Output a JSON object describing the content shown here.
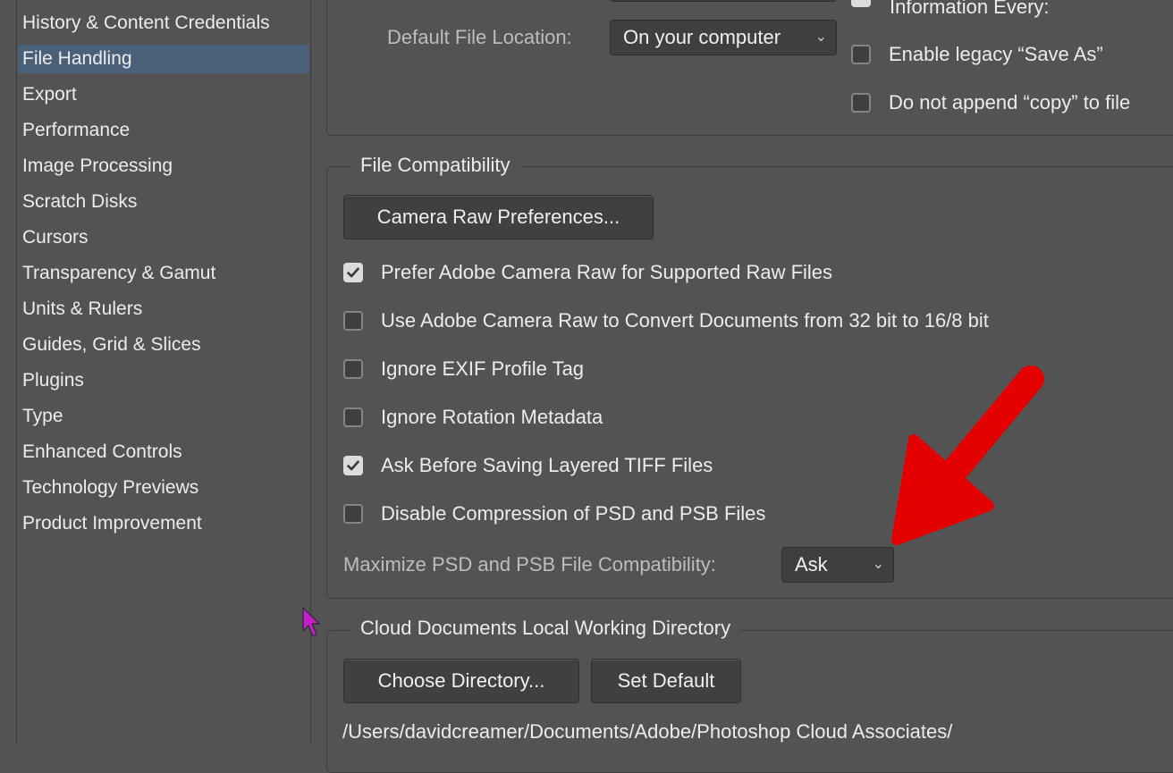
{
  "sidebar": {
    "items": [
      {
        "label": "History & Content Credentials",
        "selected": false
      },
      {
        "label": "File Handling",
        "selected": true
      },
      {
        "label": "Export",
        "selected": false
      },
      {
        "label": "Performance",
        "selected": false
      },
      {
        "label": "Image Processing",
        "selected": false
      },
      {
        "label": "Scratch Disks",
        "selected": false
      },
      {
        "label": "Cursors",
        "selected": false
      },
      {
        "label": "Transparency & Gamut",
        "selected": false
      },
      {
        "label": "Units & Rulers",
        "selected": false
      },
      {
        "label": "Guides, Grid & Slices",
        "selected": false
      },
      {
        "label": "Plugins",
        "selected": false
      },
      {
        "label": "Type",
        "selected": false
      },
      {
        "label": "Enhanced Controls",
        "selected": false
      },
      {
        "label": "Technology Previews",
        "selected": false
      },
      {
        "label": "Product Improvement",
        "selected": false
      }
    ]
  },
  "save_options": {
    "default_location_label": "Default File Location:",
    "default_location_value": "On your computer",
    "info_every_label": "Information Every:",
    "legacy_save_as": {
      "label": "Enable legacy “Save As”",
      "checked": false
    },
    "no_copy": {
      "label": "Do not append “copy” to file",
      "checked": false
    }
  },
  "file_compat": {
    "title": "File Compatibility",
    "camera_raw_button": "Camera Raw Preferences...",
    "options": [
      {
        "label": "Prefer Adobe Camera Raw for Supported Raw Files",
        "checked": true
      },
      {
        "label": "Use Adobe Camera Raw to Convert Documents from 32 bit to 16/8 bit",
        "checked": false
      },
      {
        "label": "Ignore EXIF Profile Tag",
        "checked": false
      },
      {
        "label": "Ignore Rotation Metadata",
        "checked": false
      },
      {
        "label": "Ask Before Saving Layered TIFF Files",
        "checked": true
      },
      {
        "label": "Disable Compression of PSD and PSB Files",
        "checked": false
      }
    ],
    "maximize_label": "Maximize PSD and PSB File Compatibility:",
    "maximize_value": "Ask"
  },
  "cloud_docs": {
    "title": "Cloud Documents Local Working Directory",
    "choose_button": "Choose Directory...",
    "default_button": "Set Default",
    "path": "/Users/davidcreamer/Documents/Adobe/Photoshop Cloud Associates/"
  },
  "annotation": {
    "arrow_color": "#e50000",
    "cursor_color": "#c21ec9"
  }
}
